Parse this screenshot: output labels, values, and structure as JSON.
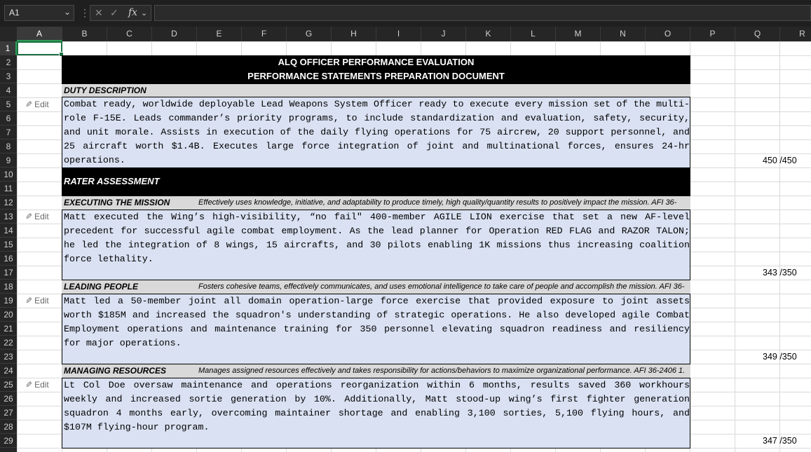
{
  "formula_bar": {
    "name_box": "A1",
    "fx": "fx",
    "cancel": "✕",
    "enter": "✓"
  },
  "columns": [
    "A",
    "B",
    "C",
    "D",
    "E",
    "F",
    "G",
    "H",
    "I",
    "J",
    "K",
    "L",
    "M",
    "N",
    "O",
    "P",
    "Q",
    "R"
  ],
  "rows": [
    "1",
    "2",
    "3",
    "4",
    "5",
    "6",
    "7",
    "8",
    "9",
    "10",
    "11",
    "12",
    "13",
    "14",
    "15",
    "16",
    "17",
    "18",
    "19",
    "20",
    "21",
    "22",
    "23",
    "24",
    "25",
    "26",
    "27",
    "28",
    "29"
  ],
  "title": {
    "line1": "ALQ OFFICER PERFORMANCE EVALUATION",
    "line2": "PERFORMANCE STATEMENTS PREPARATION DOCUMENT"
  },
  "duty": {
    "heading": "DUTY DESCRIPTION",
    "lines": [
      "Combat ready, worldwide deployable Lead Weapons System Officer ready to execute every mission set of the multi-",
      "role F-15E. Leads commander’s priority programs, to include standardization and evaluation, safety, security,",
      "and unit morale. Assists in execution of the daily flying operations for 75 aircrew, 20 support personnel, and",
      "25 aircraft worth $1.4B. Executes large force integration of joint and multinational forces, ensures 24-hr",
      "operations."
    ],
    "count": "450 /450"
  },
  "rater_heading": "RATER ASSESSMENT",
  "edit_label": "Edit",
  "sections": [
    {
      "heading": "EXECUTING THE MISSION",
      "desc": "Effectively uses knowledge, initiative, and adaptability to produce timely, high quality/quantity results to positively impact the mission. AFI 36-",
      "lines": [
        "Matt executed the Wing’s high-visibility, “no fail\" 400-member AGILE LION exercise that set a new AF-level",
        "precedent for successful agile combat employment. As the lead planner for Operation RED FLAG and RAZOR TALON;",
        "he led the integration of 8 wings, 15 aircrafts, and 30 pilots enabling 1K missions thus increasing coalition",
        "force lethality."
      ],
      "count": "343 /350"
    },
    {
      "heading": "LEADING PEOPLE",
      "desc": "Fosters cohesive teams, effectively communicates, and uses emotional intelligence to take care of people and accomplish the mission. AFI 36-",
      "lines": [
        "Matt led a 50-member joint all domain operation-large force exercise that provided exposure to joint assets",
        "worth $185M and increased the squadron's understanding of strategic operations. He also developed agile Combat",
        "Employment operations and maintenance training for 350 personnel elevating squadron readiness and resiliency",
        "for major operations."
      ],
      "count": "349 /350"
    },
    {
      "heading": "MANAGING RESOURCES",
      "desc": "Manages assigned resources effectively and takes responsibility for actions/behaviors to maximize organizational performance. AFI 36-2406 1.",
      "lines": [
        "Lt Col Doe oversaw maintenance and operations reorganization within 6 months, results saved 360 workhours",
        "weekly and increased sortie generation by 10%. Additionally, Matt stood-up wing’s first fighter generation",
        "squadron 4 months early, overcoming maintainer shortage and enabling 3,100 sorties, 5,100 flying hours, and",
        "$107M flying-hour program."
      ],
      "count": "347 /350"
    }
  ]
}
